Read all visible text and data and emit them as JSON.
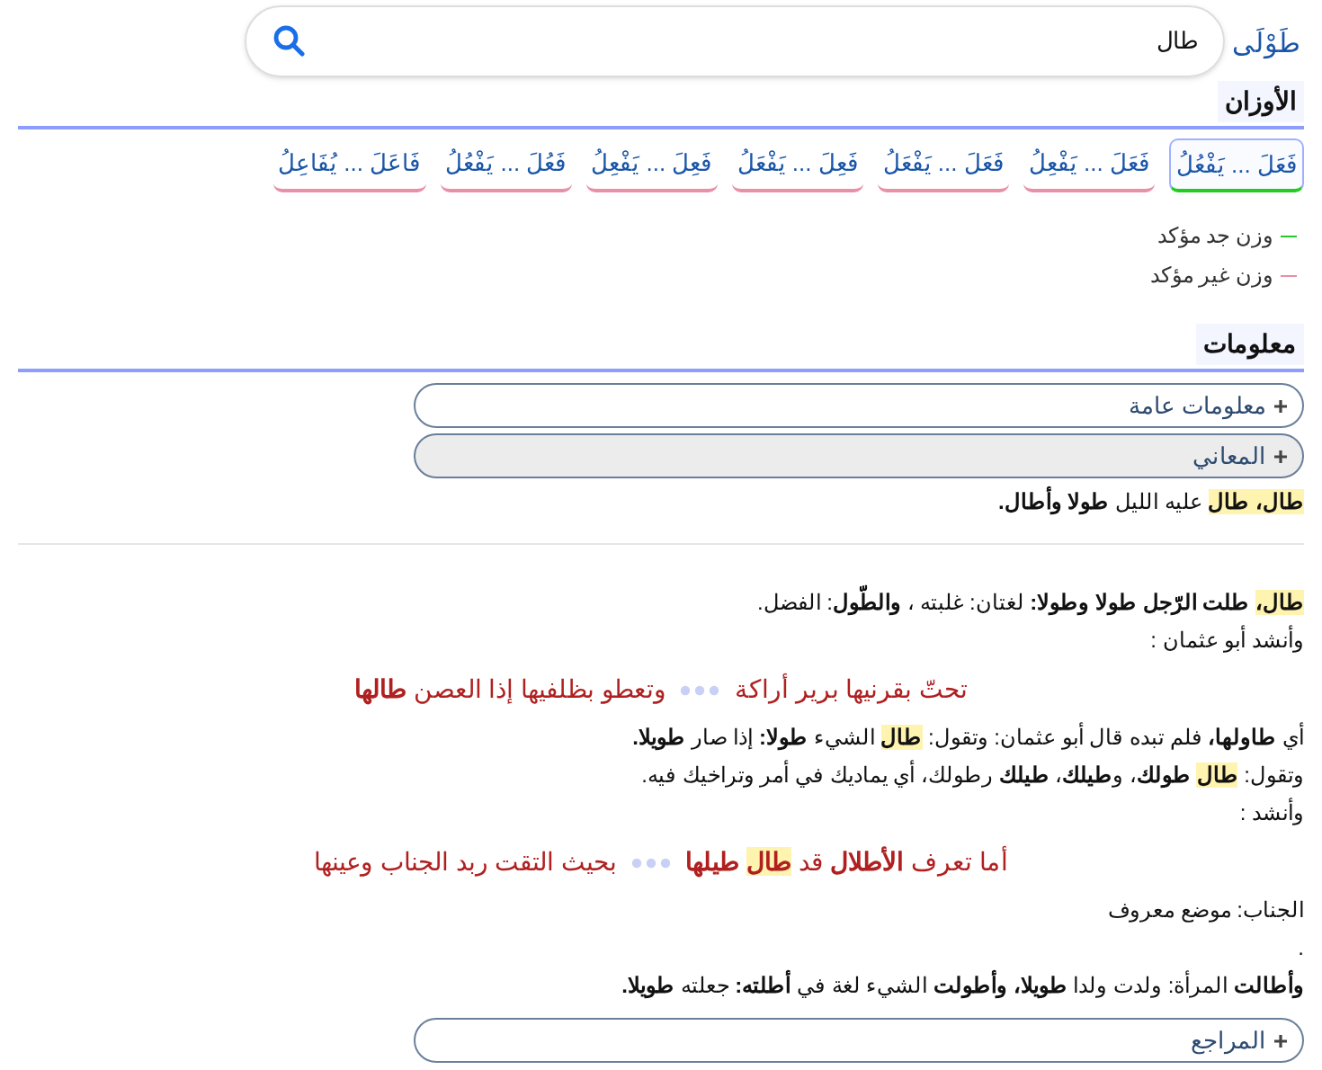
{
  "top_link": "طَوْلَى",
  "search": {
    "value": "طال"
  },
  "patterns_heading": "الأوزان",
  "patterns": [
    {
      "label": "فَعَلَ ... يَفْعُلُ",
      "confirmed": true,
      "selected": true
    },
    {
      "label": "فَعَلَ ... يَفْعِلُ",
      "confirmed": false,
      "selected": false
    },
    {
      "label": "فَعَلَ ... يَفْعَلُ",
      "confirmed": false,
      "selected": false
    },
    {
      "label": "فَعِلَ ... يَفْعَلُ",
      "confirmed": false,
      "selected": false
    },
    {
      "label": "فَعِلَ ... يَفْعِلُ",
      "confirmed": false,
      "selected": false
    },
    {
      "label": "فَعُلَ ... يَفْعُلُ",
      "confirmed": false,
      "selected": false
    },
    {
      "label": "فَاعَلَ ... يُفَاعِلُ",
      "confirmed": false,
      "selected": false
    }
  ],
  "legend": [
    {
      "label": "وزن جد مؤكد",
      "color": "#22cc22"
    },
    {
      "label": "وزن غير مؤكد",
      "color": "#e890a8"
    }
  ],
  "info_heading": "معلومات",
  "sections": [
    {
      "label": "معلومات عامة",
      "expanded": false
    },
    {
      "label": "المعاني",
      "expanded": true,
      "blocks": [
        {
          "kind": "line",
          "segments": [
            {
              "text": "**طال،** ",
              "highlight": true
            },
            {
              "text": "**طال**",
              "highlight": true
            },
            {
              "text": " عليه الليل **طولا وأطال.**",
              "highlight": false
            }
          ]
        },
        {
          "kind": "rule"
        },
        {
          "kind": "line",
          "segments": [
            {
              "text": "**طال،**",
              "highlight": true
            },
            {
              "text": " **طلت الرّجل طولا وطولا:** لغتان: غلبته ، **والطّول**: الفضل.",
              "highlight": false
            }
          ]
        },
        {
          "kind": "line",
          "segments": [
            {
              "text": "وأنشد أبو عثمان :",
              "highlight": false
            }
          ]
        },
        {
          "kind": "verse",
          "first": [
            {
              "text": "تحتّ بقرنيها برير أراكة",
              "highlight": false
            }
          ],
          "second": [
            {
              "text": "وتعطو بظلفيها إذا العصن **طالها**",
              "highlight": false
            }
          ]
        },
        {
          "kind": "line",
          "segments": [
            {
              "text": "أي **طاولها،** فلم تبده قال أبو عثمان: وتقول: ",
              "highlight": false
            },
            {
              "text": "**طال**",
              "highlight": true
            },
            {
              "text": " الشيء **طولا:** إذا صار **طويلا.**",
              "highlight": false
            }
          ]
        },
        {
          "kind": "line",
          "segments": [
            {
              "text": "وتقول: ",
              "highlight": false
            },
            {
              "text": "**طال**",
              "highlight": true
            },
            {
              "text": " **طولك**، و**طيلك**، **طيلك** رطولك، أي يماديك في أمر وتراخيك فيه.",
              "highlight": false
            }
          ]
        },
        {
          "kind": "line",
          "segments": [
            {
              "text": "وأنشد :",
              "highlight": false
            }
          ]
        },
        {
          "kind": "verse",
          "first": [
            {
              "text": "أما تعرف **الأطلال** قد ",
              "highlight": false
            },
            {
              "text": "**طال**",
              "highlight": true
            },
            {
              "text": " **طيلها**",
              "highlight": false
            }
          ],
          "second": [
            {
              "text": "بحيث التقت ربد الجناب وعينها",
              "highlight": false
            }
          ]
        },
        {
          "kind": "line",
          "segments": [
            {
              "text": "الجناب: موضع معروف",
              "highlight": false
            }
          ]
        },
        {
          "kind": "line",
          "segments": [
            {
              "text": ".",
              "highlight": false
            }
          ]
        },
        {
          "kind": "line",
          "segments": [
            {
              "text": "**وأطالت** المرأة: ولدت ولدا **طويلا،** **وأطولت** الشيء لغة في **أطلته:** جعلته **طويلا.**",
              "highlight": false
            }
          ]
        }
      ]
    },
    {
      "label": "المراجع",
      "expanded": false
    }
  ]
}
